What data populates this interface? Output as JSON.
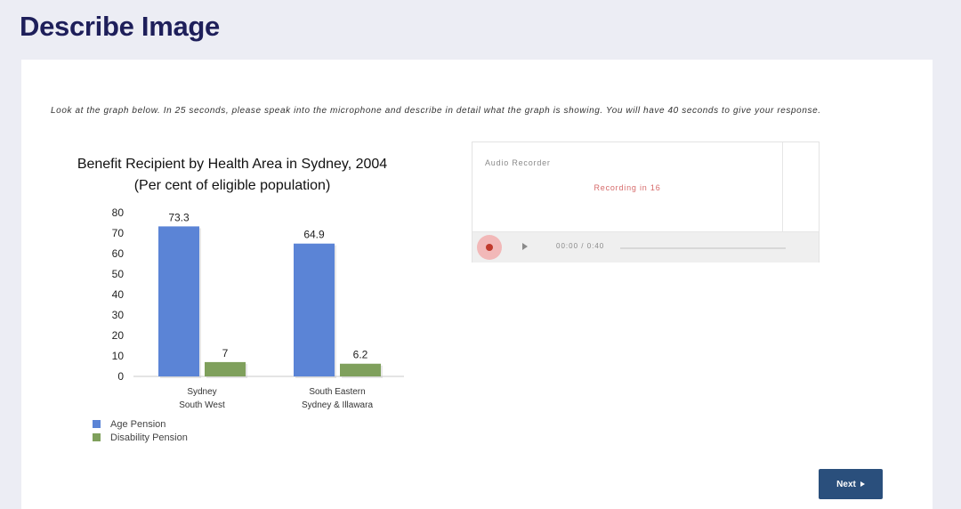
{
  "page": {
    "title": "Describe Image"
  },
  "instructions": "Look at the graph below. In 25 seconds, please speak into the microphone and describe in detail what the graph is showing. You will have 40 seconds to give your response.",
  "chart_data": {
    "type": "bar",
    "title": "Benefit Recipient by Health Area in Sydney, 2004",
    "subtitle": "(Per cent of eligible population)",
    "categories": [
      [
        "Sydney",
        "South West"
      ],
      [
        "South Eastern",
        "Sydney  & Illawara"
      ]
    ],
    "series": [
      {
        "name": "Age Pension",
        "values": [
          73.3,
          64.9
        ],
        "color": "#5b84d6"
      },
      {
        "name": "Disability Pension",
        "values": [
          7,
          6.2
        ],
        "color": "#7fa05c"
      }
    ],
    "data_labels": [
      [
        "73.3",
        "64.9"
      ],
      [
        "7",
        "6.2"
      ]
    ],
    "yticks": [
      0,
      10,
      20,
      30,
      40,
      50,
      60,
      70,
      80
    ],
    "ylim": [
      0,
      80
    ],
    "grid": false,
    "legend": "bottom-left"
  },
  "recorder": {
    "title": "Audio Recorder",
    "status": "Recording in 16",
    "time": "00:00 / 0:40",
    "record_icon": "record-icon",
    "play_icon": "play-icon"
  },
  "next_button": {
    "label": "Next",
    "icon": "chevron-right-icon"
  }
}
